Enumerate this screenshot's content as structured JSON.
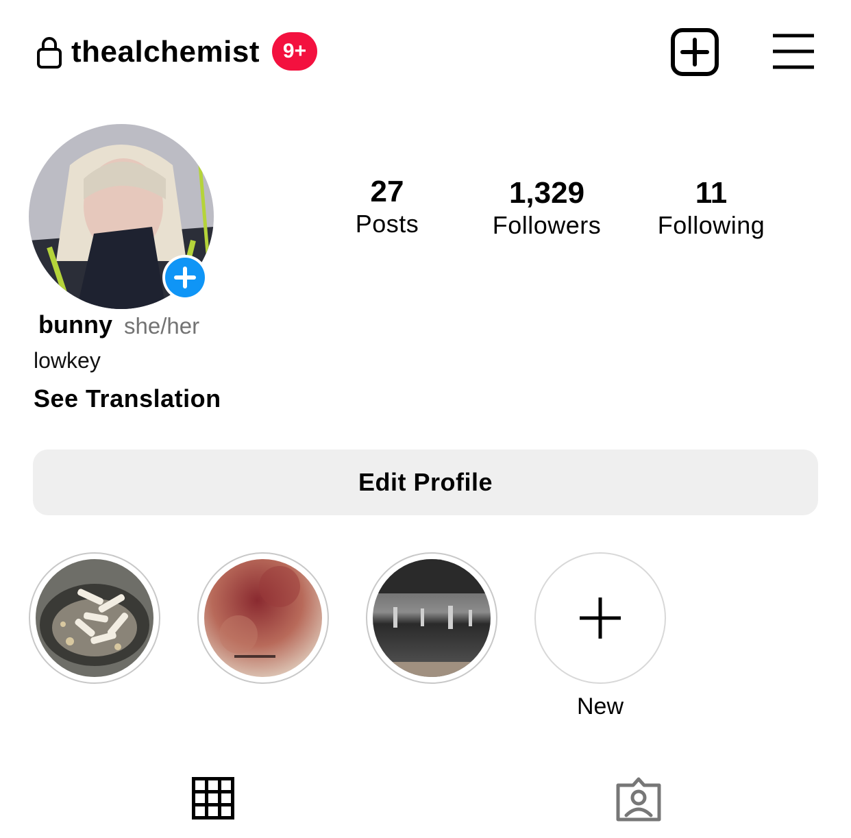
{
  "header": {
    "username": "thealchemist",
    "notification_badge": "9+",
    "icons": {
      "lock": "lock-icon",
      "new_post": "plus-square-icon",
      "menu": "hamburger-menu-icon"
    },
    "badge_color": "#f3113f"
  },
  "profile": {
    "stats": [
      {
        "count": "27",
        "label": "Posts"
      },
      {
        "count": "1,329",
        "label": "Followers"
      },
      {
        "count": "11",
        "label": "Following"
      }
    ],
    "display_name": "bunny",
    "pronouns": "she/her",
    "bio": "lowkey",
    "see_translation": "See Translation",
    "add_story_color": "#0f95f6"
  },
  "edit_profile_label": "Edit Profile",
  "highlights": [
    {
      "label": ""
    },
    {
      "label": ""
    },
    {
      "label": ""
    },
    {
      "label": "New"
    }
  ],
  "tabs": [
    {
      "icon": "grid-icon"
    },
    {
      "icon": "tagged-person-icon"
    }
  ]
}
